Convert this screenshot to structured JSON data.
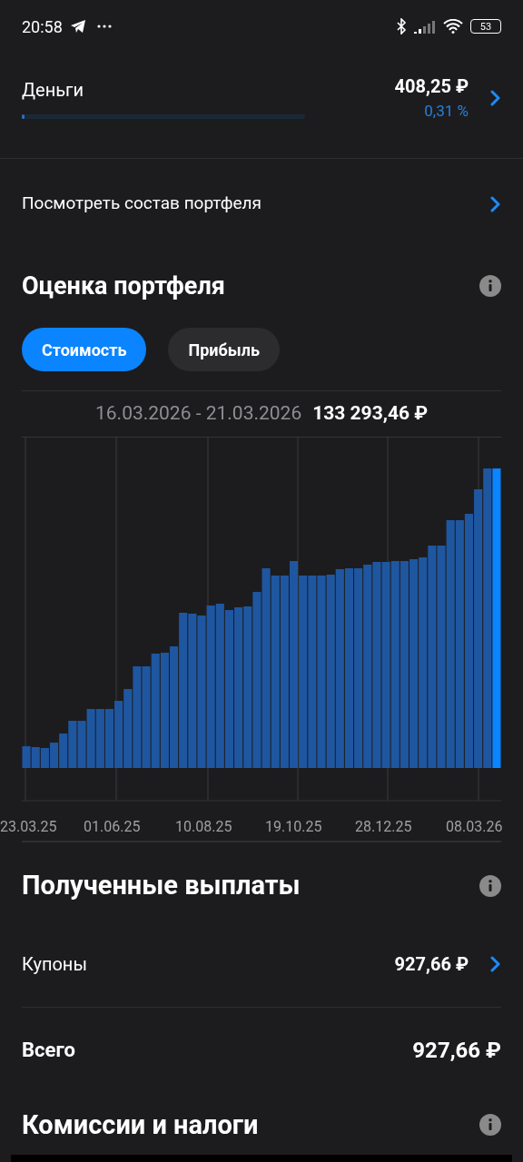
{
  "status_bar": {
    "time": "20:58",
    "battery": "53"
  },
  "money": {
    "label": "Деньги",
    "amount": "408,25 ₽",
    "change": "0,31 %",
    "level": 0.01
  },
  "portfolio_link": {
    "label": "Посмотреть состав портфеля"
  },
  "valuation": {
    "title": "Оценка портфеля",
    "tabs": [
      {
        "label": "Стоимость",
        "selected": true
      },
      {
        "label": "Прибыль",
        "selected": false
      }
    ],
    "period": "16.03.2026 - 21.03.2026",
    "total": "133 293,46 ₽",
    "chart": {
      "kind": "picture",
      "axis_labels": [
        "23.03.25",
        "01.06.25",
        "10.08.25",
        "19.10.25",
        "28.12.25",
        "08.03.26"
      ]
    }
  },
  "payouts": {
    "title": "Полученные выплаты",
    "rows": [
      {
        "label": "Купоны",
        "value": "927,66 ₽",
        "link": true
      },
      {
        "label": "Всего",
        "value": "927,66 ₽",
        "link": false
      }
    ]
  },
  "fees": {
    "title": "Комиссии и налоги"
  }
}
